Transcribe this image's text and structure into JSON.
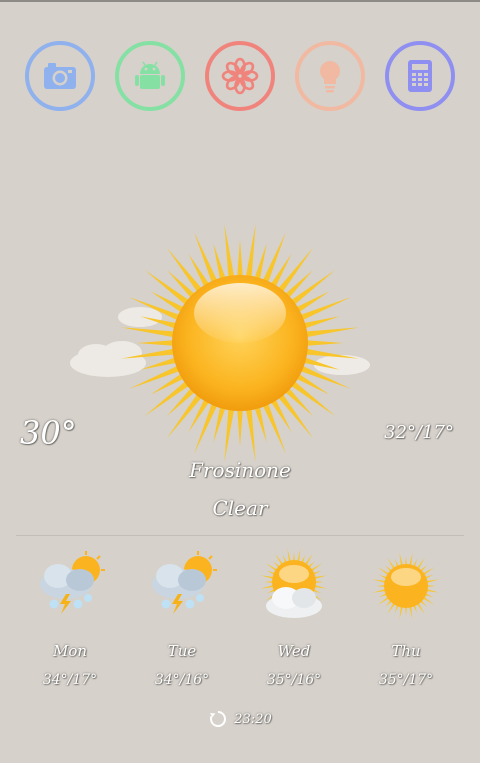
{
  "apps": [
    {
      "name": "camera-icon",
      "color": "#8fb1ee"
    },
    {
      "name": "android-icon",
      "color": "#85e0a4"
    },
    {
      "name": "gallery-flower-icon",
      "color": "#f0847d"
    },
    {
      "name": "flashlight-bulb-icon",
      "color": "#f1b9a2"
    },
    {
      "name": "calculator-icon",
      "color": "#8f8ff2"
    }
  ],
  "weather": {
    "current_temp": "30°",
    "range": "32°/17°",
    "location": "Frosinone",
    "condition": "Clear",
    "icon": "sun-icon"
  },
  "forecast": [
    {
      "day": "Mon",
      "range": "34°/17°",
      "icon": "thunderstorm-icon"
    },
    {
      "day": "Tue",
      "range": "34°/16°",
      "icon": "thunderstorm-icon"
    },
    {
      "day": "Wed",
      "range": "35°/16°",
      "icon": "partly-cloudy-icon"
    },
    {
      "day": "Thu",
      "range": "35°/17°",
      "icon": "sun-icon"
    }
  ],
  "updated": {
    "time": "23:20",
    "icon": "refresh-icon"
  }
}
